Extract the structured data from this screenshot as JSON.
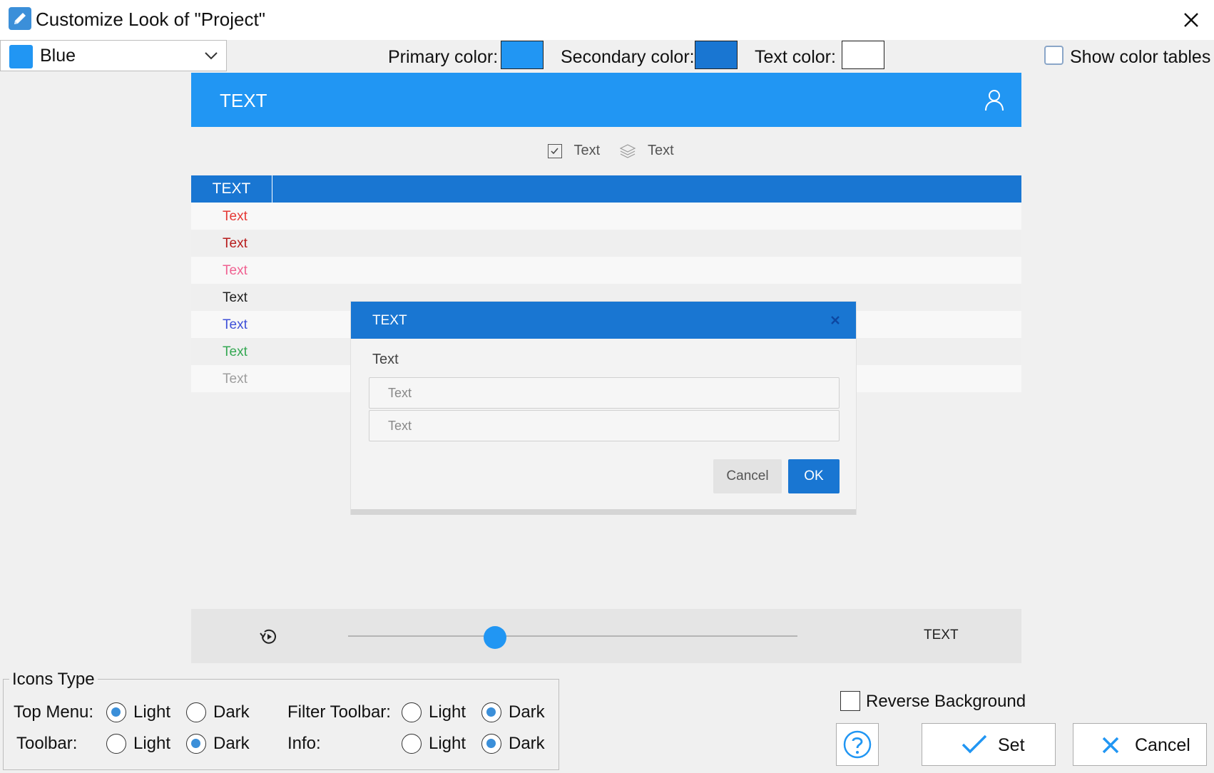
{
  "window": {
    "title": "Customize Look of \"Project\""
  },
  "theme": {
    "selected": "Blue",
    "swatch_color": "#2196f3"
  },
  "colors": {
    "primary_label": "Primary color:",
    "primary": "#2196f3",
    "secondary_label": "Secondary color:",
    "secondary": "#1976d2",
    "text_label": "Text color:",
    "text": "#ffffff"
  },
  "show_color_tables": {
    "label": "Show color tables",
    "checked": false
  },
  "preview": {
    "header_text": "TEXT",
    "checkbox_items": [
      "Text",
      "Text"
    ],
    "grid_header": "TEXT",
    "grid_rows": [
      {
        "text": "Text",
        "color": "#e53935"
      },
      {
        "text": "Text",
        "color": "#b71c1c"
      },
      {
        "text": "Text",
        "color": "#f06292"
      },
      {
        "text": "Text",
        "color": "#212121"
      },
      {
        "text": "Text",
        "color": "#3f51d8"
      },
      {
        "text": "Text",
        "color": "#34a853"
      },
      {
        "text": "Text",
        "color": "#9e9e9e"
      }
    ],
    "dialog": {
      "title": "TEXT",
      "label": "Text",
      "input1": "Text",
      "input2": "Text",
      "cancel": "Cancel",
      "ok": "OK"
    },
    "media_text": "TEXT"
  },
  "icons_type": {
    "legend": "Icons Type",
    "top_menu_label": "Top Menu:",
    "toolbar_label": "Toolbar:",
    "filter_toolbar_label": "Filter Toolbar:",
    "info_label": "Info:",
    "light": "Light",
    "dark": "Dark",
    "top_menu": "Light",
    "toolbar": "Dark",
    "filter_toolbar": "Dark",
    "info": "Dark"
  },
  "reverse_background": {
    "label": "Reverse Background",
    "checked": false
  },
  "buttons": {
    "set": "Set",
    "cancel": "Cancel"
  }
}
